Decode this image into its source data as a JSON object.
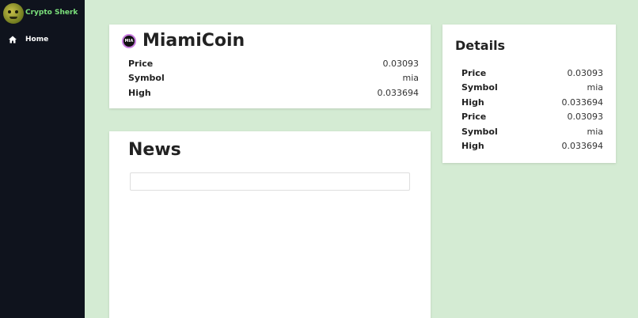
{
  "sidebar": {
    "brand": "Crypto Sherk",
    "nav": [
      {
        "label": "Home",
        "icon": "home-icon"
      }
    ]
  },
  "coin": {
    "icon_text": "MIA",
    "name": "MiamiCoin",
    "stats": [
      {
        "label": "Price",
        "value": "0.03093"
      },
      {
        "label": "Symbol",
        "value": "mia"
      },
      {
        "label": "High",
        "value": "0.033694"
      }
    ]
  },
  "news": {
    "title": "News",
    "search_value": ""
  },
  "details": {
    "title": "Details",
    "stats": [
      {
        "label": "Price",
        "value": "0.03093"
      },
      {
        "label": "Symbol",
        "value": "mia"
      },
      {
        "label": "High",
        "value": "0.033694"
      },
      {
        "label": "Price",
        "value": "0.03093"
      },
      {
        "label": "Symbol",
        "value": "mia"
      },
      {
        "label": "High",
        "value": "0.033694"
      }
    ]
  },
  "colors": {
    "background": "#d4ebd3",
    "sidebar": "#0f131d",
    "brand_text": "#7be07b"
  }
}
